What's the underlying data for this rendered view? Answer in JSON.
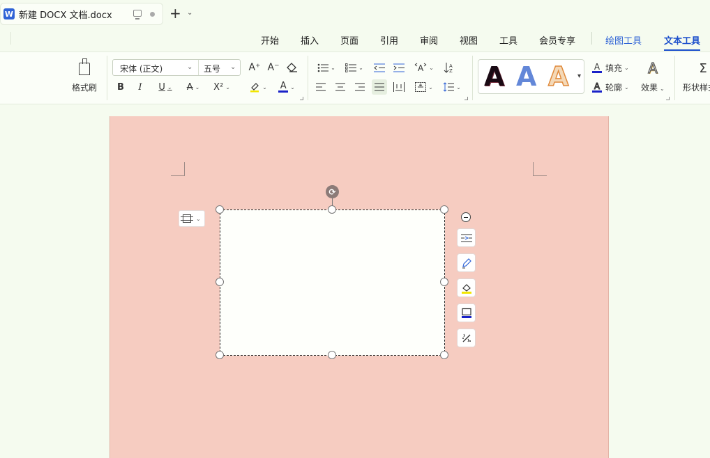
{
  "titlebar": {
    "app_icon": "W",
    "doc_name": "新建 DOCX 文档.docx",
    "new_tab": "+",
    "tab_menu": "⌄"
  },
  "menu": {
    "tabs": [
      {
        "label": "开始"
      },
      {
        "label": "插入"
      },
      {
        "label": "页面"
      },
      {
        "label": "引用"
      },
      {
        "label": "审阅"
      },
      {
        "label": "视图"
      },
      {
        "label": "工具"
      },
      {
        "label": "会员专享"
      },
      {
        "label": "绘图工具"
      },
      {
        "label": "文本工具"
      }
    ],
    "active": "文本工具"
  },
  "ribbon": {
    "format_painter": "格式刷",
    "font_name": "宋体 (正文)",
    "font_size": "五号",
    "bold": "B",
    "italic": "I",
    "underline": "U",
    "strikethrough": "A",
    "superscript": "X²",
    "grow_font": "A⁺",
    "shrink_font": "A⁻",
    "font_color_letter": "A",
    "word_art": [
      "A",
      "A",
      "A"
    ],
    "fill": "填充",
    "outline": "轮廓",
    "effects": "效果",
    "shape_style": "形状样式",
    "text_effect_glyph": "A"
  },
  "colors": {
    "accent_blue": "#1c4fcc",
    "page_fill": "#f6ccc1",
    "background": "#f5fbef",
    "font_color_bar": "#1a22c8",
    "highlight_yellow": "#f2e600"
  },
  "icons": {
    "tab": [
      "word-doc-icon",
      "monitor-icon",
      "unsaved-dot-icon",
      "plus-icon",
      "chevron-down-icon"
    ],
    "side_tools": [
      "collapse-icon",
      "text-wrap-icon",
      "pen-icon",
      "fill-bucket-icon",
      "outline-icon",
      "effects-icon"
    ],
    "rotate": "rotate-icon"
  }
}
